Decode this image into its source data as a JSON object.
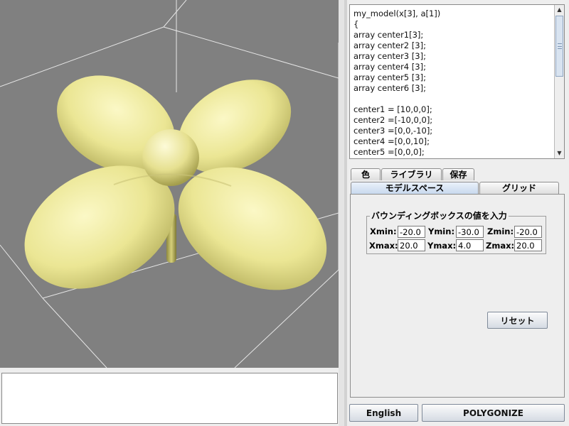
{
  "code": {
    "lines": [
      "my_model(x[3], a[1])",
      "{",
      "array center1[3];",
      "array center2 [3];",
      "array center3 [3];",
      "array center4 [3];",
      "array center5 [3];",
      "array center6 [3];",
      "",
      "center1 = [10,0,0];",
      "center2 =[-10,0,0];",
      "center3 =[0,0,-10];",
      "center4 =[0,0,10];",
      "center5 =[0,0,0];"
    ]
  },
  "tabs": {
    "color": "色",
    "library": "ライブラリ",
    "save": "保存",
    "model_space": "モデルスペース",
    "grid": "グリッド"
  },
  "bbox": {
    "title": "バウンディングボックスの値を入力",
    "xmin_label": "Xmin:",
    "xmin": "-20.0",
    "ymin_label": "Ymin:",
    "ymin": "-30.0",
    "zmin_label": "Zmin:",
    "zmin": "-20.0",
    "xmax_label": "Xmax:",
    "xmax": "20.0",
    "ymax_label": "Ymax:",
    "ymax": "4.0",
    "zmax_label": "Zmax:",
    "zmax": "20.0"
  },
  "buttons": {
    "reset": "リセット",
    "english": "English",
    "polygonize": "POLYGONIZE"
  },
  "colors": {
    "viewport_bg": "#808080",
    "model": "#f3f0a0",
    "active_tab": "#c8d9ee"
  }
}
